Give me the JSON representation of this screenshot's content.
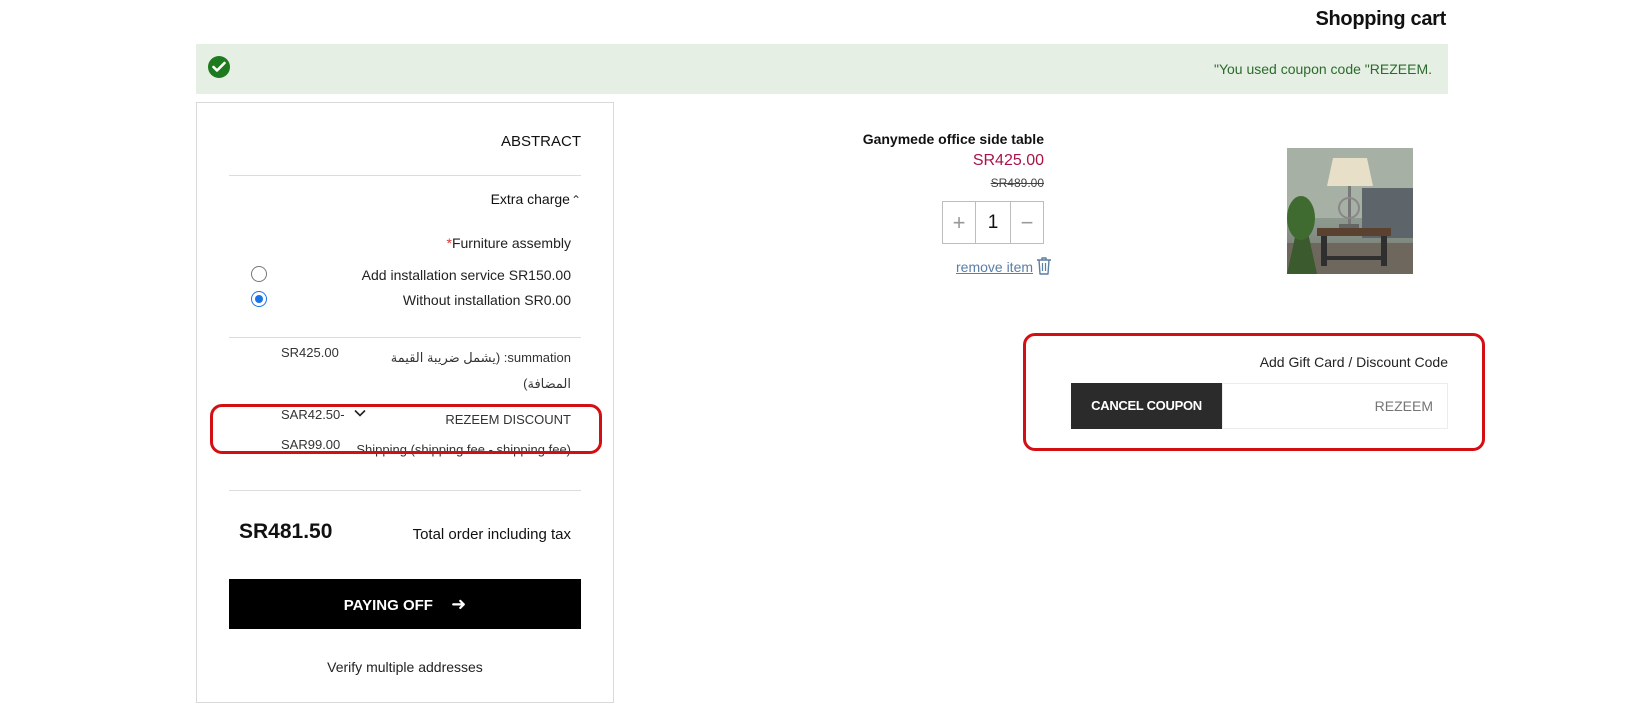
{
  "page": {
    "title": "Shopping cart"
  },
  "notice": {
    "message": "\"You used coupon code \"REZEEM.",
    "icon": "check-circle-icon",
    "color": "#2c6b2c"
  },
  "summary": {
    "title": "ABSTRACT",
    "extra_charge": "Extra charge",
    "assembly_label": "Furniture assembly",
    "assembly_required_mark": "*",
    "options": [
      {
        "label": "Add installation service SR150.00",
        "selected": false
      },
      {
        "label": "Without installation SR0.00",
        "selected": true
      }
    ],
    "lines": {
      "subtotal_label": "summation: (يشمل ضريبة القيمة المضافة)",
      "subtotal_amount": "SR425.00",
      "discount_label": "REZEEM DISCOUNT",
      "discount_amount": "SAR42.50-",
      "shipping_label": "Shipping (shipping fee - shipping fee)",
      "shipping_amount": "SAR99.00"
    },
    "total_amount": "SR481.50",
    "total_label": "Total order including tax",
    "pay_button": "PAYING OFF",
    "verify_link": "Verify multiple addresses"
  },
  "product": {
    "name": "Ganymede office side table",
    "price": "SR425.00",
    "old_price": "SR489.00",
    "quantity": "1",
    "remove_label": "remove item",
    "price_color": "#a8144a"
  },
  "coupon": {
    "label": "Add Gift Card / Discount Code",
    "cancel_button": "CANCEL COUPON",
    "placeholder": "REZEEM"
  },
  "colors": {
    "highlight": "#d40f14",
    "accent": "#1a73e8"
  }
}
